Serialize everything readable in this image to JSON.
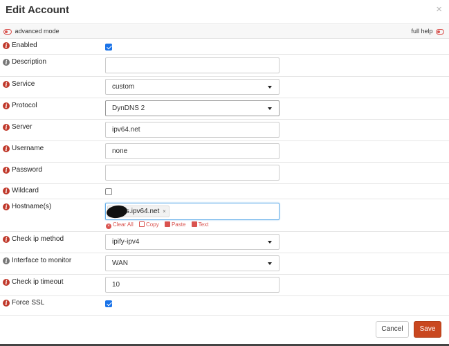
{
  "modal": {
    "title": "Edit Account",
    "close_glyph": "×"
  },
  "mode_bar": {
    "advanced_mode_label": "advanced mode",
    "full_help_label": "full help"
  },
  "fields": {
    "enabled": {
      "label": "Enabled",
      "checked": true
    },
    "description": {
      "label": "Description",
      "value": ""
    },
    "service": {
      "label": "Service",
      "value": "custom"
    },
    "protocol": {
      "label": "Protocol",
      "value": "DynDNS 2"
    },
    "server": {
      "label": "Server",
      "value": "ipv64.net"
    },
    "username": {
      "label": "Username",
      "value": "none"
    },
    "password": {
      "label": "Password",
      "value": ""
    },
    "wildcard": {
      "label": "Wildcard",
      "checked": false
    },
    "hostnames": {
      "label": "Hostname(s)",
      "tags": [
        {
          "text": "s.ipv64.net",
          "remove_glyph": "×"
        }
      ],
      "actions": {
        "clear_all": "Clear All",
        "copy": "Copy",
        "paste": "Paste",
        "text": "Text"
      }
    },
    "check_ip_method": {
      "label": "Check ip method",
      "value": "ipify-ipv4"
    },
    "interface": {
      "label": "Interface to monitor",
      "value": "WAN"
    },
    "check_ip_timeout": {
      "label": "Check ip timeout",
      "value": "10"
    },
    "force_ssl": {
      "label": "Force SSL",
      "checked": true
    }
  },
  "footer": {
    "cancel_label": "Cancel",
    "save_label": "Save"
  },
  "colors": {
    "accent": "#c9471f",
    "info_red": "#c0392b",
    "info_gray": "#777777",
    "checkbox_blue": "#1a73e8"
  },
  "icons": {
    "info": "i",
    "clear": "×"
  }
}
